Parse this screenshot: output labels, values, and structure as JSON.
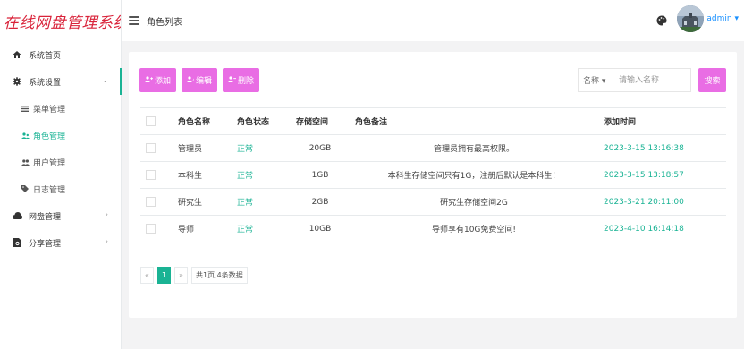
{
  "app": {
    "logo_text": "在线网盘管理系统"
  },
  "header": {
    "page_title": "角色列表",
    "user": "admin ▾"
  },
  "sidebar": {
    "items": [
      {
        "label": "系统首页",
        "icon": "home-icon"
      },
      {
        "label": "系统设置",
        "icon": "gear-icon",
        "arrow": "⌄"
      }
    ],
    "sub_items": [
      {
        "label": "菜单管理",
        "icon": "list-icon"
      },
      {
        "label": "角色管理",
        "icon": "users-icon"
      },
      {
        "label": "用户管理",
        "icon": "user-group-icon"
      },
      {
        "label": "日志管理",
        "icon": "tag-icon"
      }
    ],
    "items_after": [
      {
        "label": "网盘管理",
        "icon": "cloud-icon",
        "arrow": "›"
      },
      {
        "label": "分享管理",
        "icon": "share-file-icon",
        "arrow": "›"
      }
    ]
  },
  "toolbar": {
    "add_label": "添加",
    "edit_label": "编辑",
    "delete_label": "删除"
  },
  "search": {
    "field_select": "名称 ▾",
    "placeholder": "请输入名称",
    "button_label": "搜索"
  },
  "table": {
    "columns": [
      "角色名称",
      "角色状态",
      "存储空间",
      "角色备注",
      "添加时间"
    ],
    "rows": [
      {
        "name": "管理员",
        "status": "正常",
        "storage": "20GB",
        "remark": "管理员拥有最高权限。",
        "time": "2023-3-15 13:16:38"
      },
      {
        "name": "本科生",
        "status": "正常",
        "storage": "1GB",
        "remark": "本科生存储空间只有1G，注册后默认是本科生！",
        "time": "2023-3-15 13:18:57"
      },
      {
        "name": "研究生",
        "status": "正常",
        "storage": "2GB",
        "remark": "研究生存储空间2G",
        "time": "2023-3-21 20:11:00"
      },
      {
        "name": "导师",
        "status": "正常",
        "storage": "10GB",
        "remark": "导师享有10G免费空间!",
        "time": "2023-4-10 16:14:18"
      }
    ]
  },
  "pager": {
    "prev": "«",
    "current": "1",
    "next": "»",
    "info": "共1页,4条数据"
  },
  "colors": {
    "accent": "#1ab394",
    "button": "#e96de4",
    "logo": "#d9233a",
    "link": "#1890ff"
  }
}
